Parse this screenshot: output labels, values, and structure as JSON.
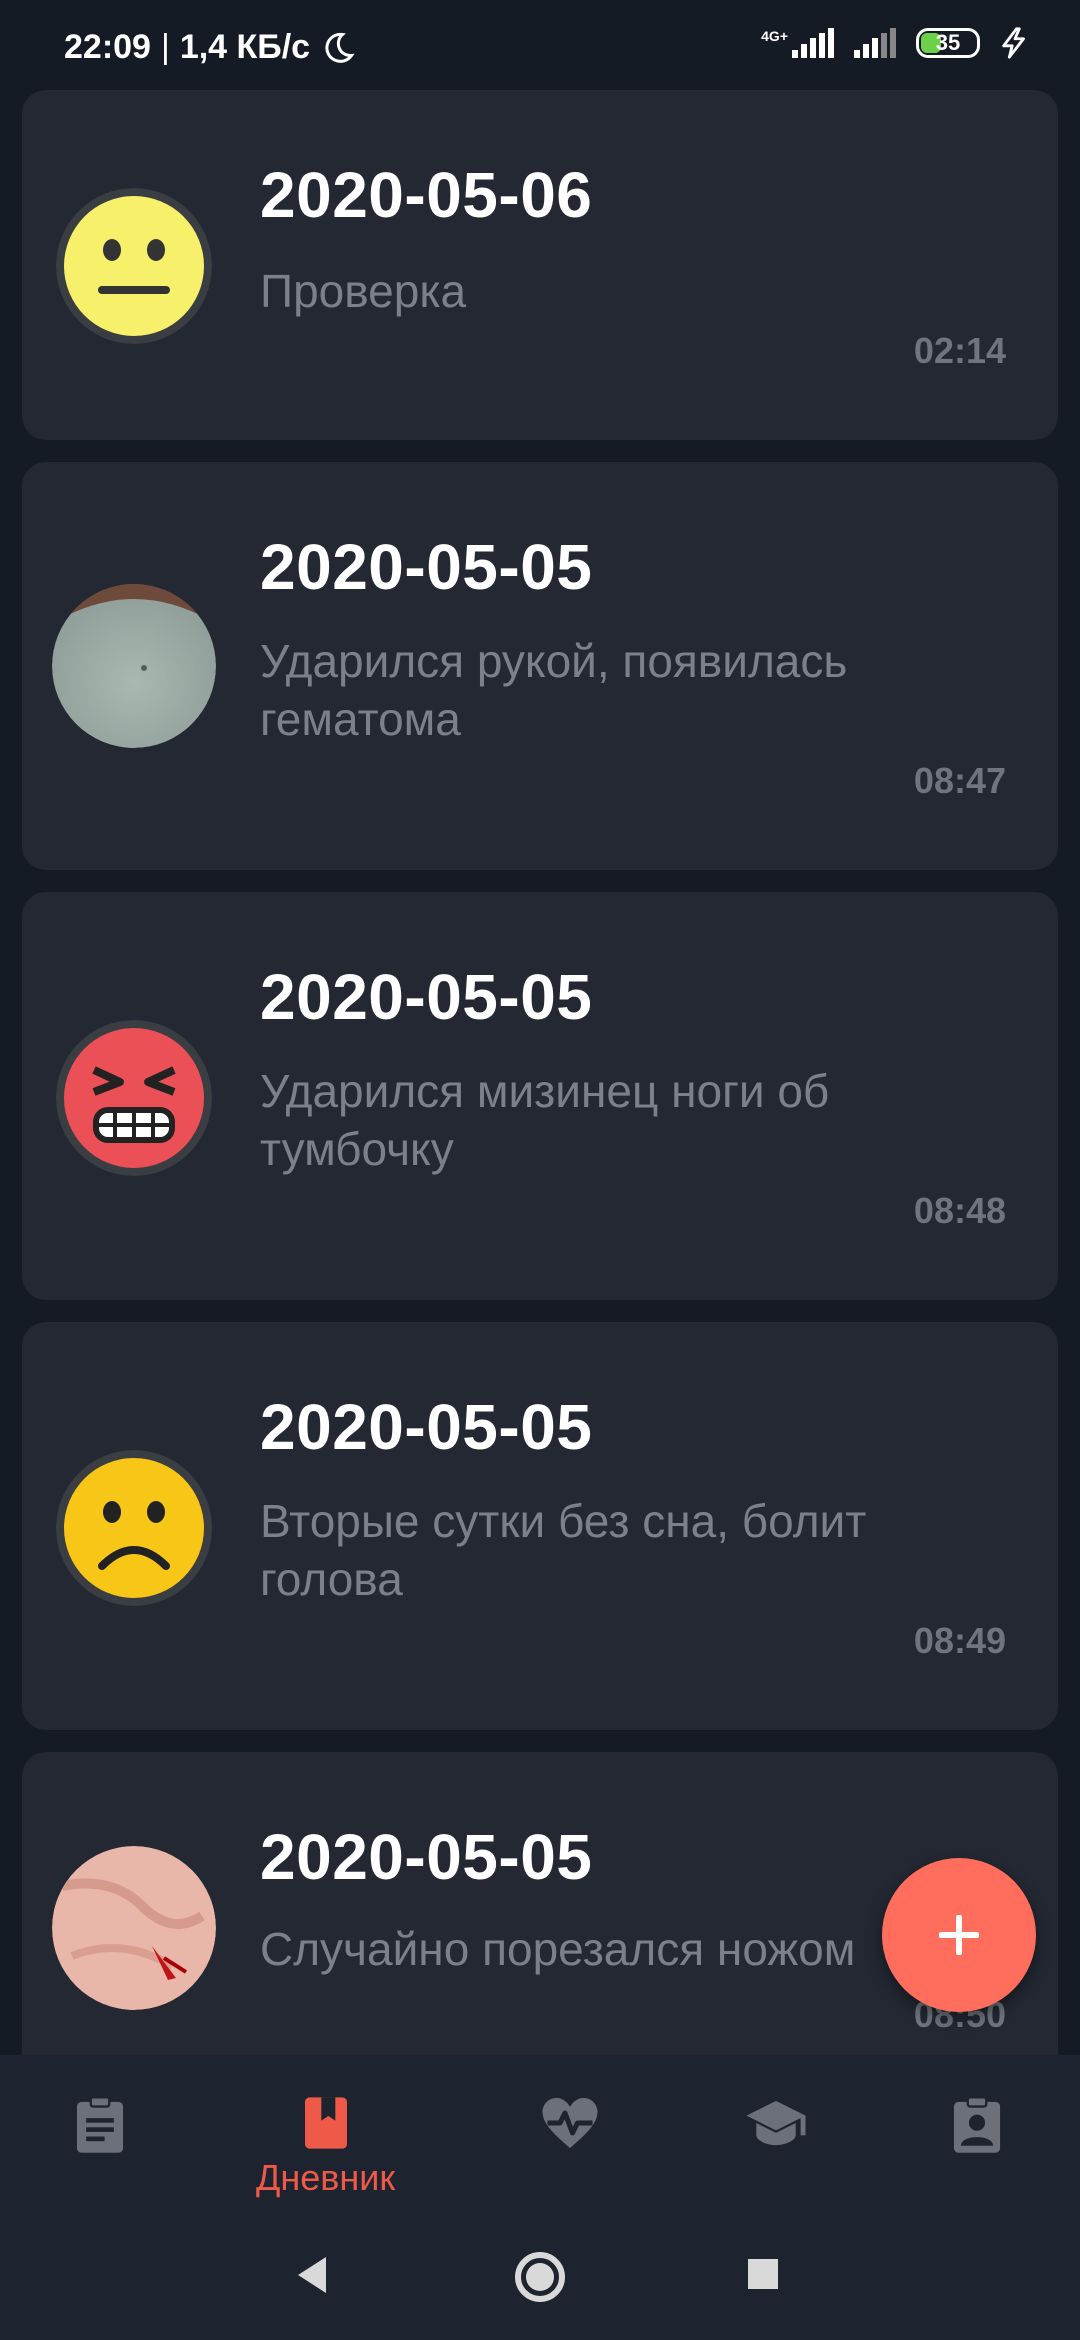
{
  "status_bar": {
    "time": "22:09",
    "speed": "1,4 КБ/с",
    "network": "4G+",
    "battery": "35"
  },
  "entries": [
    {
      "date": "2020-05-06",
      "text": "Проверка",
      "time": "02:14",
      "avatar": "neutral-face-emoji"
    },
    {
      "date": "2020-05-05",
      "text": "Ударился рукой, появилась гематома",
      "time": "08:47",
      "avatar": "bruise-photo"
    },
    {
      "date": "2020-05-05",
      "text": "Ударился мизинец ноги об тумбочку",
      "time": "08:48",
      "avatar": "angry-face-emoji"
    },
    {
      "date": "2020-05-05",
      "text": "Вторые сутки без сна, болит голова",
      "time": "08:49",
      "avatar": "frowning-face-emoji"
    },
    {
      "date": "2020-05-05",
      "text": "Случайно порезался ножом",
      "time": "08:50",
      "avatar": "cut-finger-photo"
    }
  ],
  "fab": {
    "icon": "plus-icon"
  },
  "bottom_nav": {
    "items": [
      {
        "icon": "clipboard-icon",
        "label": ""
      },
      {
        "icon": "diary-bookmark-icon",
        "label": "Дневник",
        "active": true
      },
      {
        "icon": "heart-pulse-icon",
        "label": ""
      },
      {
        "icon": "graduation-cap-icon",
        "label": ""
      },
      {
        "icon": "profile-badge-icon",
        "label": ""
      }
    ],
    "active_color": "#ee5a47",
    "inactive_color": "#6b707a"
  },
  "colors": {
    "background": "#151b25",
    "card": "#232833",
    "fab": "#ff6e5c"
  }
}
